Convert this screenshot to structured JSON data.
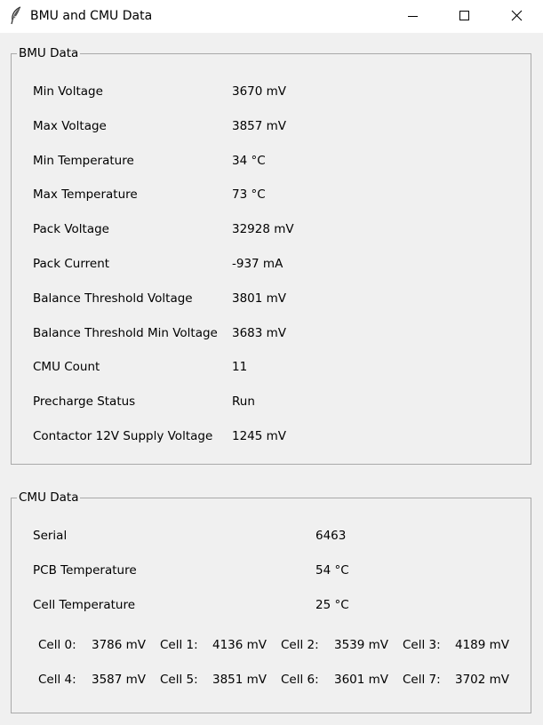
{
  "window": {
    "title": "BMU and CMU Data",
    "icon": "feather-icon",
    "controls": [
      "minimize-icon",
      "maximize-icon",
      "close-icon"
    ]
  },
  "bmu": {
    "legend": "BMU Data",
    "rows": [
      {
        "label": "Min Voltage",
        "value": "3670 mV"
      },
      {
        "label": "Max Voltage",
        "value": "3857 mV"
      },
      {
        "label": "Min Temperature",
        "value": "34 °C"
      },
      {
        "label": "Max Temperature",
        "value": "73 °C"
      },
      {
        "label": "Pack Voltage",
        "value": "32928 mV"
      },
      {
        "label": "Pack Current",
        "value": "-937 mA"
      },
      {
        "label": "Balance Threshold Voltage",
        "value": "3801 mV"
      },
      {
        "label": "Balance Threshold Min Voltage",
        "value": "3683 mV"
      },
      {
        "label": "CMU Count",
        "value": "11"
      },
      {
        "label": "Precharge Status",
        "value": "Run"
      },
      {
        "label": "Contactor 12V Supply Voltage",
        "value": "1245 mV"
      }
    ]
  },
  "cmu": {
    "legend": "CMU Data",
    "rows": [
      {
        "label": "Serial",
        "value": "6463"
      },
      {
        "label": "PCB Temperature",
        "value": "54 °C"
      },
      {
        "label": "Cell Temperature",
        "value": "25 °C"
      }
    ],
    "cells": [
      {
        "label": "Cell 0:",
        "value": "3786 mV"
      },
      {
        "label": "Cell 1:",
        "value": "4136 mV"
      },
      {
        "label": "Cell 2:",
        "value": "3539 mV"
      },
      {
        "label": "Cell 3:",
        "value": "4189 mV"
      },
      {
        "label": "Cell 4:",
        "value": "3587 mV"
      },
      {
        "label": "Cell 5:",
        "value": "3851 mV"
      },
      {
        "label": "Cell 6:",
        "value": "3601 mV"
      },
      {
        "label": "Cell 7:",
        "value": "3702 mV"
      }
    ]
  }
}
